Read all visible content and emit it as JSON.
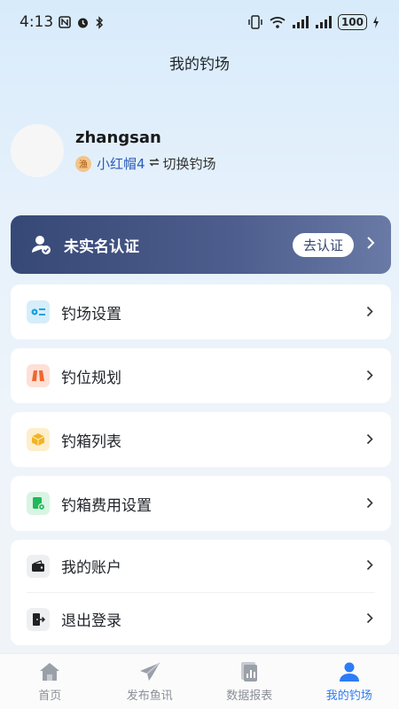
{
  "status_bar": {
    "time": "4:13",
    "battery": "100"
  },
  "header": {
    "title": "我的钓场"
  },
  "profile": {
    "username": "zhangsan",
    "badge": "渔",
    "farm_name": "小红帽4",
    "switch_label": "切换钓场"
  },
  "verify": {
    "label": "未实名认证",
    "button": "去认证"
  },
  "menu": {
    "settings": "钓场设置",
    "planning": "钓位规划",
    "box_list": "钓箱列表",
    "box_fee": "钓箱费用设置",
    "account": "我的账户",
    "logout": "退出登录"
  },
  "tabbar": {
    "home": "首页",
    "publish": "发布鱼讯",
    "reports": "数据报表",
    "mine": "我的钓场"
  },
  "colors": {
    "accent": "#2d7cf6",
    "banner": "#3e4f80",
    "settings_icon_bg": "#d9f0fb",
    "planning_icon_bg": "#fde3dc",
    "boxlist_icon_bg": "#fdf0cf",
    "boxfee_icon_bg": "#dcf6e6",
    "account_icon_bg": "#f0f0f2"
  }
}
